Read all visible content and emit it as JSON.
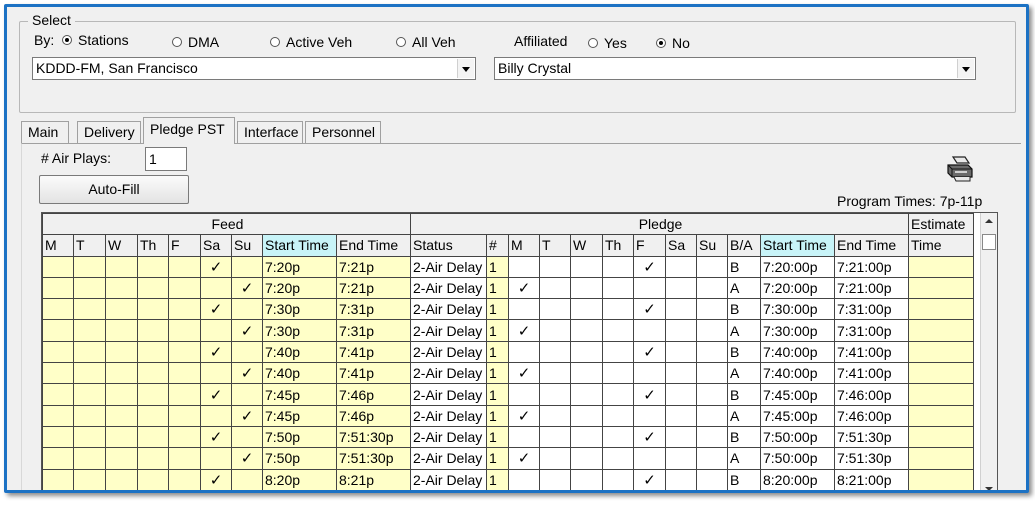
{
  "select_group": {
    "title": "Select",
    "by_label": "By:",
    "by_options": [
      {
        "label": "Stations",
        "selected": true
      },
      {
        "label": "DMA",
        "selected": false
      },
      {
        "label": "Active Veh",
        "selected": false
      },
      {
        "label": "All Veh",
        "selected": false
      }
    ],
    "affiliated_label": "Affiliated",
    "affiliated_options": [
      {
        "label": "Yes",
        "selected": false
      },
      {
        "label": "No",
        "selected": true
      }
    ],
    "station_value": "KDDD-FM, San Francisco",
    "person_value": "Billy Crystal"
  },
  "tabs": [
    {
      "label": "Main",
      "active": false
    },
    {
      "label": "Delivery",
      "active": false
    },
    {
      "label": "Pledge PST",
      "active": true
    },
    {
      "label": "Interface",
      "active": false
    },
    {
      "label": "Personnel",
      "active": false
    }
  ],
  "pledge": {
    "air_plays_label": "# Air Plays:",
    "air_plays_value": "1",
    "autofill_label": "Auto-Fill",
    "program_times": "Program Times: 7p-11p",
    "printer_icon": "printer-icon"
  },
  "grid": {
    "group_headers": {
      "feed": "Feed",
      "pledge": "Pledge",
      "estimate": "Estimate"
    },
    "columns": [
      "M",
      "T",
      "W",
      "Th",
      "F",
      "Sa",
      "Su",
      "Start Time",
      "End Time",
      "Status",
      "#",
      "M",
      "T",
      "W",
      "Th",
      "F",
      "Sa",
      "Su",
      "B/A",
      "Start Time",
      "End Time",
      "Time"
    ],
    "check_glyph": "✓",
    "rows": [
      {
        "feed_day": "Sa",
        "feed_start": "7:20p",
        "feed_end": "7:21p",
        "status": "2-Air Delay",
        "num": "1",
        "pledge_day": "F",
        "ba": "B",
        "start": "7:20:00p",
        "end": "7:21:00p"
      },
      {
        "feed_day": "Su",
        "feed_start": "7:20p",
        "feed_end": "7:21p",
        "status": "2-Air Delay",
        "num": "1",
        "pledge_day": "M",
        "ba": "A",
        "start": "7:20:00p",
        "end": "7:21:00p"
      },
      {
        "feed_day": "Sa",
        "feed_start": "7:30p",
        "feed_end": "7:31p",
        "status": "2-Air Delay",
        "num": "1",
        "pledge_day": "F",
        "ba": "B",
        "start": "7:30:00p",
        "end": "7:31:00p"
      },
      {
        "feed_day": "Su",
        "feed_start": "7:30p",
        "feed_end": "7:31p",
        "status": "2-Air Delay",
        "num": "1",
        "pledge_day": "M",
        "ba": "A",
        "start": "7:30:00p",
        "end": "7:31:00p"
      },
      {
        "feed_day": "Sa",
        "feed_start": "7:40p",
        "feed_end": "7:41p",
        "status": "2-Air Delay",
        "num": "1",
        "pledge_day": "F",
        "ba": "B",
        "start": "7:40:00p",
        "end": "7:41:00p"
      },
      {
        "feed_day": "Su",
        "feed_start": "7:40p",
        "feed_end": "7:41p",
        "status": "2-Air Delay",
        "num": "1",
        "pledge_day": "M",
        "ba": "A",
        "start": "7:40:00p",
        "end": "7:41:00p"
      },
      {
        "feed_day": "Sa",
        "feed_start": "7:45p",
        "feed_end": "7:46p",
        "status": "2-Air Delay",
        "num": "1",
        "pledge_day": "F",
        "ba": "B",
        "start": "7:45:00p",
        "end": "7:46:00p"
      },
      {
        "feed_day": "Su",
        "feed_start": "7:45p",
        "feed_end": "7:46p",
        "status": "2-Air Delay",
        "num": "1",
        "pledge_day": "M",
        "ba": "A",
        "start": "7:45:00p",
        "end": "7:46:00p"
      },
      {
        "feed_day": "Sa",
        "feed_start": "7:50p",
        "feed_end": "7:51:30p",
        "status": "2-Air Delay",
        "num": "1",
        "pledge_day": "F",
        "ba": "B",
        "start": "7:50:00p",
        "end": "7:51:30p"
      },
      {
        "feed_day": "Su",
        "feed_start": "7:50p",
        "feed_end": "7:51:30p",
        "status": "2-Air Delay",
        "num": "1",
        "pledge_day": "M",
        "ba": "A",
        "start": "7:50:00p",
        "end": "7:51:30p"
      },
      {
        "feed_day": "Sa",
        "feed_start": "8:20p",
        "feed_end": "8:21p",
        "status": "2-Air Delay",
        "num": "1",
        "pledge_day": "F",
        "ba": "B",
        "start": "8:20:00p",
        "end": "8:21:00p"
      }
    ]
  },
  "colors": {
    "frame_border": "#1c72c4",
    "row_fill": "#ffffc8",
    "header_highlight": "#c8f4f8"
  }
}
